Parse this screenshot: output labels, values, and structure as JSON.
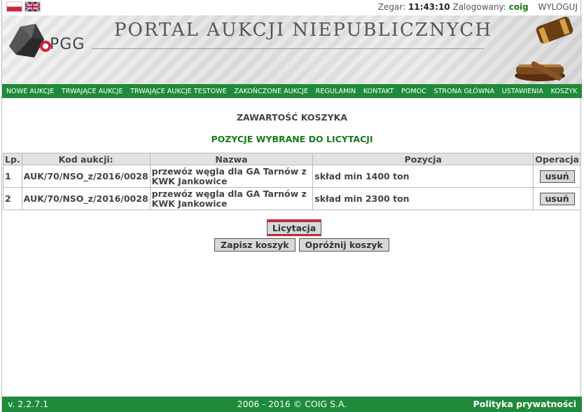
{
  "topbar": {
    "clock_label": "Zegar:",
    "clock_value": "11:43:10",
    "logged_label": "Zalogowany:",
    "user": "coig",
    "logout": "WYLOGUJ"
  },
  "header": {
    "logo_text": "PGG",
    "title": "PORTAL AUKCJI NIEPUBLICZNYCH"
  },
  "nav": [
    "NOWE AUKCJE",
    "TRWAJĄCE AUKCJE",
    "TRWAJĄCE AUKCJE TESTOWE",
    "ZAKOŃCZONE AUKCJE",
    "REGULAMIN",
    "KONTAKT",
    "POMOC",
    "STRONA GŁÓWNA",
    "USTAWIENIA",
    "KOSZYK"
  ],
  "cart": {
    "heading": "ZAWARTOŚĆ KOSZYKA",
    "subheading": "POZYCJE WYBRANE DO LICYTACJI",
    "columns": [
      "Lp.",
      "Kod aukcji:",
      "Nazwa",
      "Pozycja",
      "Operacja"
    ],
    "rows": [
      {
        "lp": "1",
        "code": "AUK/70/NSO_z/2016/0028",
        "name": "przewóz węgla dla GA Tarnów z KWK Jankowice",
        "position": "skład min 1400 ton",
        "action": "usuń"
      },
      {
        "lp": "2",
        "code": "AUK/70/NSO_z/2016/0028",
        "name": "przewóz węgla dla GA Tarnów z KWK Jankowice",
        "position": "skład min 2300 ton",
        "action": "usuń"
      }
    ],
    "btn_licytacja": "Licytacja",
    "btn_save": "Zapisz koszyk",
    "btn_empty": "Opróżnij koszyk"
  },
  "footer": {
    "version": "v. 2.2.7.1",
    "copyright": "2006 - 2016 © COIG S.A.",
    "privacy": "Polityka prywatności"
  },
  "colors": {
    "accent_green": "#1e8a3a",
    "highlight_red": "#e0222a"
  }
}
